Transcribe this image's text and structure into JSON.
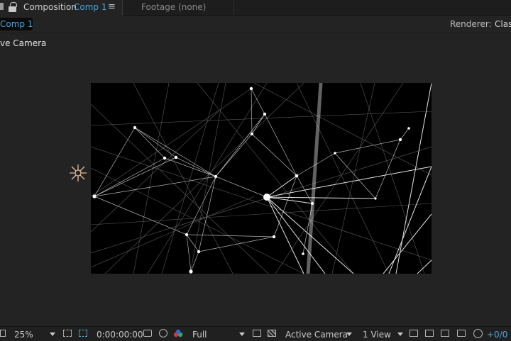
{
  "tabs": {
    "composition": {
      "label": "Composition",
      "name": "Comp 1",
      "menu_glyph": "≡"
    },
    "footage": {
      "label": "Footage (none)"
    }
  },
  "subbar": {
    "comp_label": "Comp 1",
    "renderer_label": "Renderer:",
    "renderer_value": "Clas"
  },
  "viewer": {
    "camera_label": "ve Camera"
  },
  "bottom": {
    "zoom": "25%",
    "timecode": "0:00:00:00",
    "resolution": "Full",
    "view": "Active Camera",
    "layout": "1 View",
    "exposure": "+0/0"
  },
  "colors": {
    "accent": "#4fa3d8",
    "panel": "#232323",
    "canvas": "#000000",
    "light_icon": "#e0b89a"
  },
  "icons": {
    "light": "light-icon",
    "lock": "lock-icon",
    "menu": "panel-menu-icon"
  }
}
